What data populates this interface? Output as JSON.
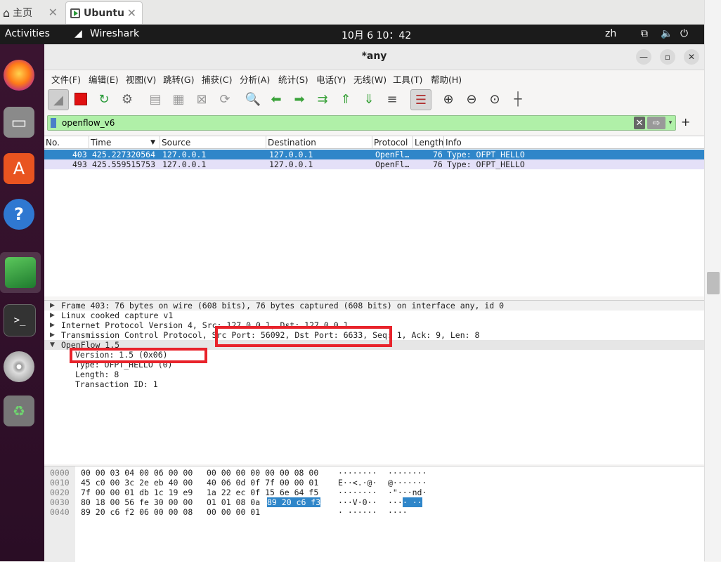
{
  "browser_tabs": [
    {
      "label": "主页",
      "icon": "home-icon"
    },
    {
      "label": "Ubuntu",
      "icon": "vm-icon"
    }
  ],
  "topbar": {
    "activities": "Activities",
    "app": "Wireshark",
    "clock": "10月 6  10：42",
    "lang": "zh"
  },
  "window": {
    "title": "*any"
  },
  "menu": [
    "文件(F)",
    "编辑(E)",
    "视图(V)",
    "跳转(G)",
    "捕获(C)",
    "分析(A)",
    "统计(S)",
    "电话(Y)",
    "无线(W)",
    "工具(T)",
    "帮助(H)"
  ],
  "filter": {
    "value": "openflow_v6"
  },
  "packet_list": {
    "columns": [
      "No.",
      "Time",
      "Source",
      "Destination",
      "Protocol",
      "Length",
      "Info"
    ],
    "rows": [
      {
        "no": "403",
        "time": "425.227320564",
        "source": "127.0.0.1",
        "destination": "127.0.0.1",
        "protocol": "OpenFl…",
        "length": "76",
        "info": "Type: OFPT_HELLO",
        "selected": true
      },
      {
        "no": "493",
        "time": "425.559515753",
        "source": "127.0.0.1",
        "destination": "127.0.0.1",
        "protocol": "OpenFl…",
        "length": "76",
        "info": "Type: OFPT_HELLO",
        "selected": false
      }
    ]
  },
  "details": {
    "frame": "Frame 403: 76 bytes on wire (608 bits), 76 bytes captured (608 bits) on interface any, id 0",
    "linux": "Linux cooked capture v1",
    "ip": "Internet Protocol Version 4, Src: 127.0.0.1, Dst: 127.0.0.1",
    "tcp": "Transmission Control Protocol, Src Port: 56092, Dst Port: 6633, Seq: 1, Ack: 9, Len: 8",
    "openflow": "OpenFlow 1.5",
    "version": "Version: 1.5 (0x06)",
    "type": "Type: OFPT_HELLO (0)",
    "length": "Length: 8",
    "xid": "Transaction ID: 1"
  },
  "bytes": {
    "rows": [
      {
        "offset": "0000",
        "hex_a": "00 00 03 04 00 06 00 00",
        "hex_b": "00 00 00 00 00 00 08 00",
        "ascii_a": "········",
        "ascii_b": "········"
      },
      {
        "offset": "0010",
        "hex_a": "45 c0 00 3c 2e eb 40 00",
        "hex_b": "40 06 0d 0f 7f 00 00 01",
        "ascii_a": "E··<.·@·",
        "ascii_b": "@·······"
      },
      {
        "offset": "0020",
        "hex_a": "7f 00 00 01 db 1c 19 e9",
        "hex_b": "1a 22 ec 0f 15 6e 64 f5",
        "ascii_a": "········",
        "ascii_b": "·\"···nd·"
      },
      {
        "offset": "0030",
        "hex_a": "80 18 00 56 fe 30 00 00",
        "hex_b": "01 01 08 0a",
        "hex_b_sel": "89 20 c6 f3",
        "ascii_a": "···V·0··",
        "ascii_b": "····",
        "ascii_b_sel": "· ··"
      },
      {
        "offset": "0040",
        "hex_a": "89 20 c6 f2 06 00 00 08",
        "hex_b": "00 00 00 01",
        "ascii_a": "· ······",
        "ascii_b": "····"
      }
    ]
  }
}
